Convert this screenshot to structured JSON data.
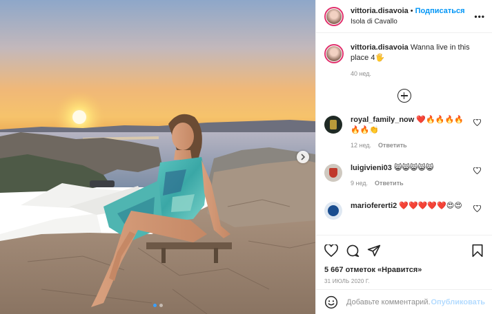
{
  "post": {
    "author": {
      "username": "vittoria.disavoia",
      "follow_label": "Подписаться",
      "location": "Isola di Cavallo",
      "separator": "•"
    },
    "more_icon": "more-horizontal-icon",
    "caption": {
      "username": "vittoria.disavoia",
      "text": "Wanna live in this place 4🖐",
      "time": "40 нед."
    },
    "load_more_icon": "plus-circle-icon",
    "comments": [
      {
        "username": "royal_family_now",
        "text": "❤️🔥🔥🔥🔥🔥🔥👏",
        "time": "12 нед.",
        "reply_label": "Ответить",
        "avatar_color": "#1f2a25"
      },
      {
        "username": "luigivieni03",
        "text": "😸😸😸😸😸",
        "time": "9 нед.",
        "reply_label": "Ответить",
        "avatar_color": "#cfc9c0"
      },
      {
        "username": "mariofererti2",
        "text": "❤️❤️❤️❤️❤️😍😍",
        "time": "",
        "reply_label": "",
        "avatar_color": "#1a4d8f"
      }
    ],
    "actions": {
      "like_icon": "heart-icon",
      "comment_icon": "comment-icon",
      "share_icon": "paper-plane-icon",
      "save_icon": "bookmark-icon"
    },
    "likes": "5 667 отметок «Нравится»",
    "date": "31 ИЮЛЬ 2020 Г.",
    "add_comment": {
      "emoji_icon": "smiley-icon",
      "placeholder": "Добавьте комментарий...",
      "publish_label": "Опубликовать"
    },
    "carousel": {
      "next_icon": "chevron-right-icon",
      "dots": 2,
      "active_dot": 1
    },
    "colors": {
      "follow": "#0095f6",
      "publish_disabled": "#b3dbff",
      "story_ring": "#e1306c",
      "carousel_active_dot": "#3aa0ff"
    }
  }
}
